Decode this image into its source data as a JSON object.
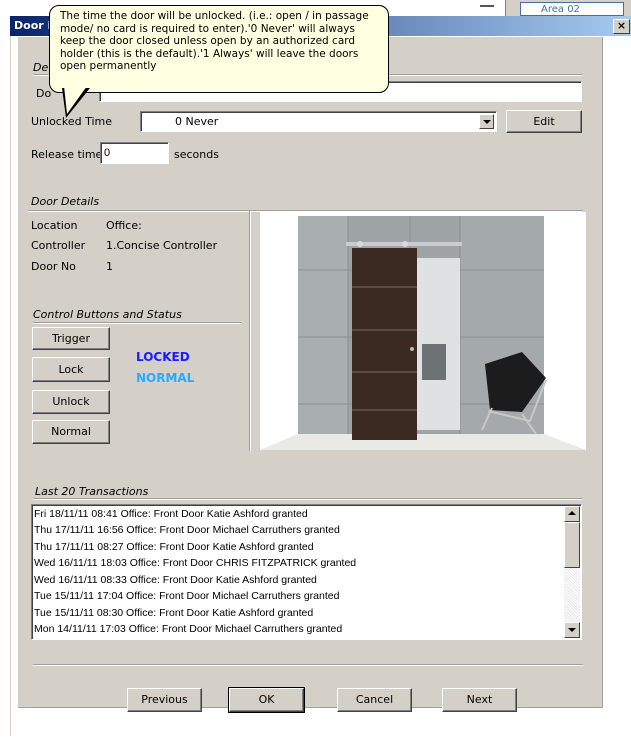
{
  "background_window": {
    "area_tab": "Area 02"
  },
  "window": {
    "title": "Door i",
    "close_label": "×"
  },
  "tooltip": {
    "text": "The time the door will be unlocked. (i.e.: open / in passage mode/ no card is required to enter).'0 Never' will always keep the door closed unless open by an authorized card holder (this is the default).'1 Always' will leave the doors open permanently"
  },
  "door_settings": {
    "group_title": "De",
    "door_name_label": "Do",
    "door_name_value": "",
    "unlocked_time_label": "Unlocked Time",
    "unlocked_time_value": "0 Never",
    "edit_label": "Edit",
    "release_time_label": "Release time",
    "release_time_value": "0",
    "release_time_unit": "seconds"
  },
  "door_details": {
    "group_title": "Door Details",
    "rows": [
      {
        "label": "Location",
        "value": "Office:"
      },
      {
        "label": "Controller",
        "value": "1.Concise Controller"
      },
      {
        "label": "Door No",
        "value": "1"
      }
    ]
  },
  "control": {
    "group_title": "Control Buttons and Status",
    "buttons": [
      "Trigger",
      "Lock",
      "Unlock",
      "Normal"
    ],
    "status_lock": "LOCKED",
    "status_mode": "NORMAL",
    "colors": {
      "locked": "#1a1aff",
      "normal": "#2aaaff"
    }
  },
  "transactions": {
    "group_title": "Last 20 Transactions",
    "items": [
      "Fri 18/11/11 08:41 Office: Front Door Katie Ashford granted",
      "Thu 17/11/11 16:56 Office: Front Door Michael Carruthers granted",
      "Thu 17/11/11 08:27 Office: Front Door Katie Ashford granted",
      "Wed 16/11/11 18:03 Office: Front Door CHRIS FITZPATRICK granted",
      "Wed 16/11/11 08:33 Office: Front Door Katie Ashford granted",
      "Tue 15/11/11 17:04 Office: Front Door Michael Carruthers granted",
      "Tue 15/11/11 08:30 Office: Front Door Katie Ashford granted",
      "Mon 14/11/11 17:03 Office: Front Door Michael Carruthers granted"
    ]
  },
  "footer": {
    "previous": "Previous",
    "ok": "OK",
    "cancel": "Cancel",
    "next": "Next"
  }
}
